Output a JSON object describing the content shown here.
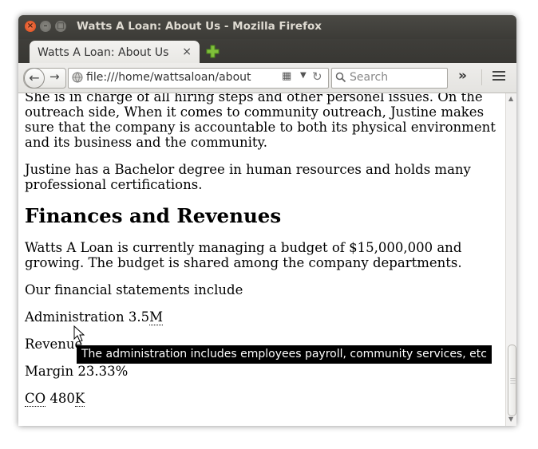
{
  "window": {
    "title": "Watts A Loan: About Us - Mozilla Firefox",
    "close_glyph": "×",
    "minimize_glyph": "–",
    "maximize_glyph": "□"
  },
  "tab": {
    "title": "Watts A Loan: About Us",
    "close_glyph": "×"
  },
  "navbar": {
    "back_glyph": "←",
    "forward_glyph": "→",
    "url": "file:///home/wattsaloan/about",
    "reload_glyph": "↻",
    "search_placeholder": "Search",
    "overflow_glyph": "»",
    "icons": [
      "back-arrow-icon",
      "forward-arrow-icon",
      "globe-icon",
      "reader-view-icon",
      "dropdown-arrow-icon",
      "reload-icon",
      "search-icon",
      "overflow-chevron-icon",
      "hamburger-menu-icon",
      "new-tab-plus-icon"
    ]
  },
  "page": {
    "para1": "She is in charge of all hiring steps and other personel issues. On the outreach side, When it comes to community outreach, Justine makes sure that the company is accountable to both its physical environment and its business and the community.",
    "para2": "Justine has a Bachelor degree in human resources and holds many professional certifications.",
    "heading": "Finances and Revenues",
    "para3": "Watts A Loan is currently managing a budget of $15,000,000 and growing. The budget is shared among the company departments.",
    "para4": "Our financial statements include",
    "admin_label": "Administration 3.5",
    "admin_abbr": "M",
    "revenue_label": "Revenue",
    "margin_label": "Margin 23.33%",
    "co_abbr": "CO",
    "co_value": " 480",
    "co_suffix": "K"
  },
  "tooltip": {
    "text": "The administration includes employees payroll, community services, etc"
  },
  "colors": {
    "titlebar": "#3c3b37",
    "close_button": "#df4a16",
    "new_tab_plus": "#7fbf3a"
  }
}
